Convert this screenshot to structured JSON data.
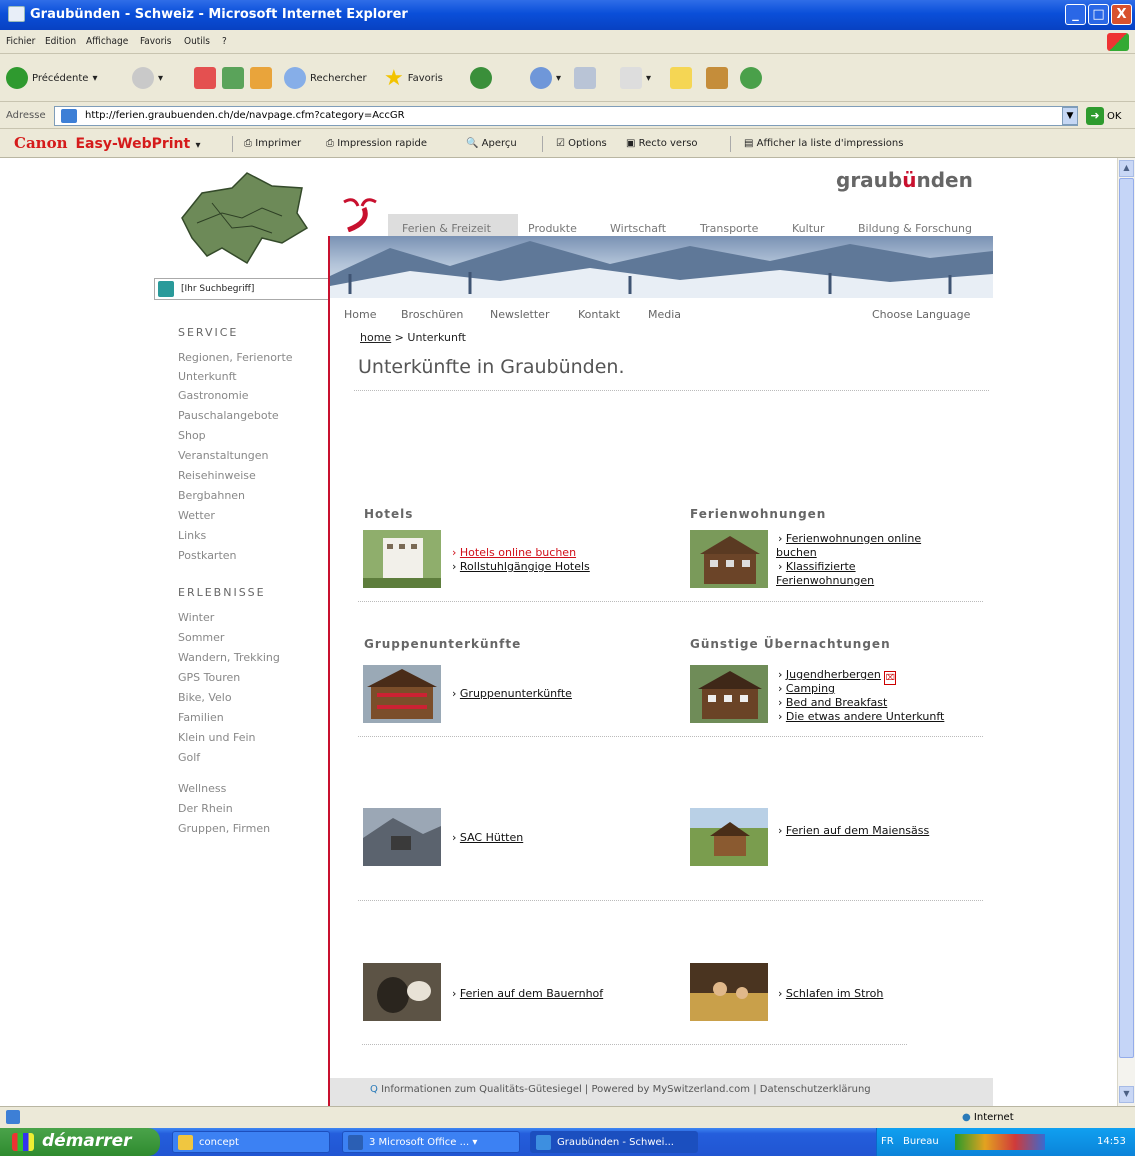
{
  "window": {
    "title": "Graubünden - Schweiz - Microsoft Internet Explorer",
    "minimize": "_",
    "maximize": "□",
    "close": "X"
  },
  "menu": [
    "Fichier",
    "Edition",
    "Affichage",
    "Favoris",
    "Outils",
    "?"
  ],
  "toolbar": {
    "back": "Précédente",
    "search": "Rechercher",
    "favorites": "Favoris"
  },
  "address": {
    "label": "Adresse",
    "url": "http://ferien.graubuenden.ch/de/navpage.cfm?category=AccGR",
    "go": "OK"
  },
  "canon": {
    "brand": "Canon",
    "product": "Easy-WebPrint",
    "items": [
      "Imprimer",
      "Impression rapide",
      "Aperçu",
      "Options",
      "Recto verso",
      "Afficher la liste d'impressions"
    ]
  },
  "page": {
    "search_placeholder": "[Ihr Suchbegriff]",
    "logo_left": "graub",
    "logo_mid": "ü",
    "logo_right": "nden",
    "topnav": [
      "Ferien & Freizeit",
      "Produkte",
      "Wirtschaft",
      "Transporte",
      "Kultur",
      "Bildung & Forschung"
    ],
    "subnav": [
      "Home",
      "Broschüren",
      "Newsletter",
      "Kontakt",
      "Media"
    ],
    "choose_language": "Choose Language",
    "breadcrumb_home": "home",
    "breadcrumb_rest": " > Unterkunft",
    "title": "Unterkünfte in Graubünden.",
    "service_heading": "SERVICE",
    "service": [
      "Regionen, Ferienorte",
      "Unterkunft",
      "Gastronomie",
      "Pauschalangebote",
      "Shop",
      "Veranstaltungen",
      "Reisehinweise",
      "Bergbahnen",
      "Wetter",
      "Links",
      "Postkarten"
    ],
    "erlebnisse_heading": "ERLEBNISSE",
    "erlebnisse": [
      "Winter",
      "Sommer",
      "Wandern, Trekking",
      "GPS Touren",
      "Bike, Velo",
      "Familien",
      "Klein und Fein",
      "Golf",
      "Wellness",
      "Der Rhein",
      "Gruppen, Firmen"
    ],
    "cat_hotels": "Hotels",
    "hotels_links": [
      "Hotels online buchen",
      "Rollstuhlgängige Hotels"
    ],
    "cat_fewo": "Ferienwohnungen",
    "fewo_links": [
      "Ferienwohnungen online buchen",
      "Klassifizierte Ferienwohnungen"
    ],
    "cat_gruppen": "Gruppenunterkünfte",
    "gruppen_links": [
      "Gruppenunterkünfte"
    ],
    "cat_guenstig": "Günstige Übernachtungen",
    "guenstig_links": [
      "Jugendherbergen",
      "Camping",
      "Bed and Breakfast",
      "Die etwas andere Unterkunft"
    ],
    "sac": "SAC Hütten",
    "maiensaess": "Ferien auf dem Maiensäss",
    "bauernhof": "Ferien auf dem Bauernhof",
    "stroh": "Schlafen im Stroh",
    "footer": "Informationen zum Qualitäts-Gütesiegel  |  Powered by MySwitzerland.com  |  Datenschutzerklärung"
  },
  "status": {
    "zone": "Internet"
  },
  "taskbar": {
    "start": "démarrer",
    "tasks": [
      "concept",
      "3 Microsoft Office ...",
      "Graubünden - Schwei..."
    ],
    "lang": "FR",
    "bureau": "Bureau",
    "time": "14:53"
  },
  "colors": {
    "accent": "#c8102e",
    "xp_blue": "#0a4fd9",
    "start_green": "#3a9a3a"
  }
}
